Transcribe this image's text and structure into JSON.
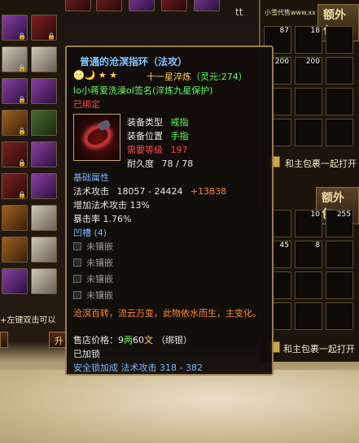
{
  "window": {
    "ad_text": "小雪代售www.xx",
    "tt": "tt"
  },
  "left_grid": {
    "bottom_hint": "+左键双击可以",
    "button_label": "升"
  },
  "right_panel": {
    "header1": "额外包",
    "header2": "额外包",
    "bag_button1": "和主包裹一起打开",
    "bag_button2": "和主包裹一起打开",
    "top_slots": [
      {
        "count": "87",
        "icon": "blue-pot-icon"
      },
      {
        "count": "18",
        "icon": "white-vase-icon"
      },
      {
        "count": "200",
        "icon": "potion-icon"
      },
      {
        "count": "200",
        "icon": "flower-icon"
      }
    ],
    "bottom_slots": [
      {
        "count": "",
        "icon": "green-leaf-icon"
      },
      {
        "count": "10",
        "icon": "scroll-icon"
      },
      {
        "count": "255",
        "icon": "bag-icon"
      },
      {
        "count": "45",
        "icon": "green-orb-icon"
      },
      {
        "count": "8",
        "icon": "gold-bundle-icon"
      },
      {
        "count": "",
        "icon": "purple-crystal-icon"
      }
    ]
  },
  "tooltip": {
    "title": "普通的沧溟指环（法攻）",
    "refine": "十一星淬炼",
    "soul_value": "（灵元:274）",
    "signature": "Io小蒋爱洗澡oI签名(淬炼九星保护)",
    "bound": "已绑定",
    "equip_type_label": "装备类型",
    "equip_type_value": "戒指",
    "equip_pos_label": "装备位置",
    "equip_pos_value": "手指",
    "level_req_label": "需要等级",
    "level_req_value": "197",
    "durability_label": "耐久度",
    "durability_value": "78 / 78",
    "basic_attr_header": "基础属性",
    "magic_attack_label": "法术攻击",
    "magic_attack_value": "18057 - 24424",
    "magic_attack_plus": "+13838",
    "magic_attack_pct": "增加法术攻击 13%",
    "crit": "暴击率  1.76%",
    "sockets_header": "凹槽 (4)",
    "socket_label": "未镶嵌",
    "flavor": "沧溟百转，流云万变，此物依水而生，主变化。",
    "price_label": "售店价格：",
    "price_gold": "9",
    "price_gold_unit": "两",
    "price_silver": "60",
    "price_silver_unit": "文",
    "price_bind": "（绑银）",
    "lock_status": "已加锁",
    "bonus": "安全锁加成  法术攻击 318 - 382"
  },
  "colors": {
    "title_blue": "#83c7ff",
    "green": "#62ff62",
    "red": "#ff4a4a",
    "orange": "#ff8a2a",
    "gold": "#ffd24a"
  }
}
